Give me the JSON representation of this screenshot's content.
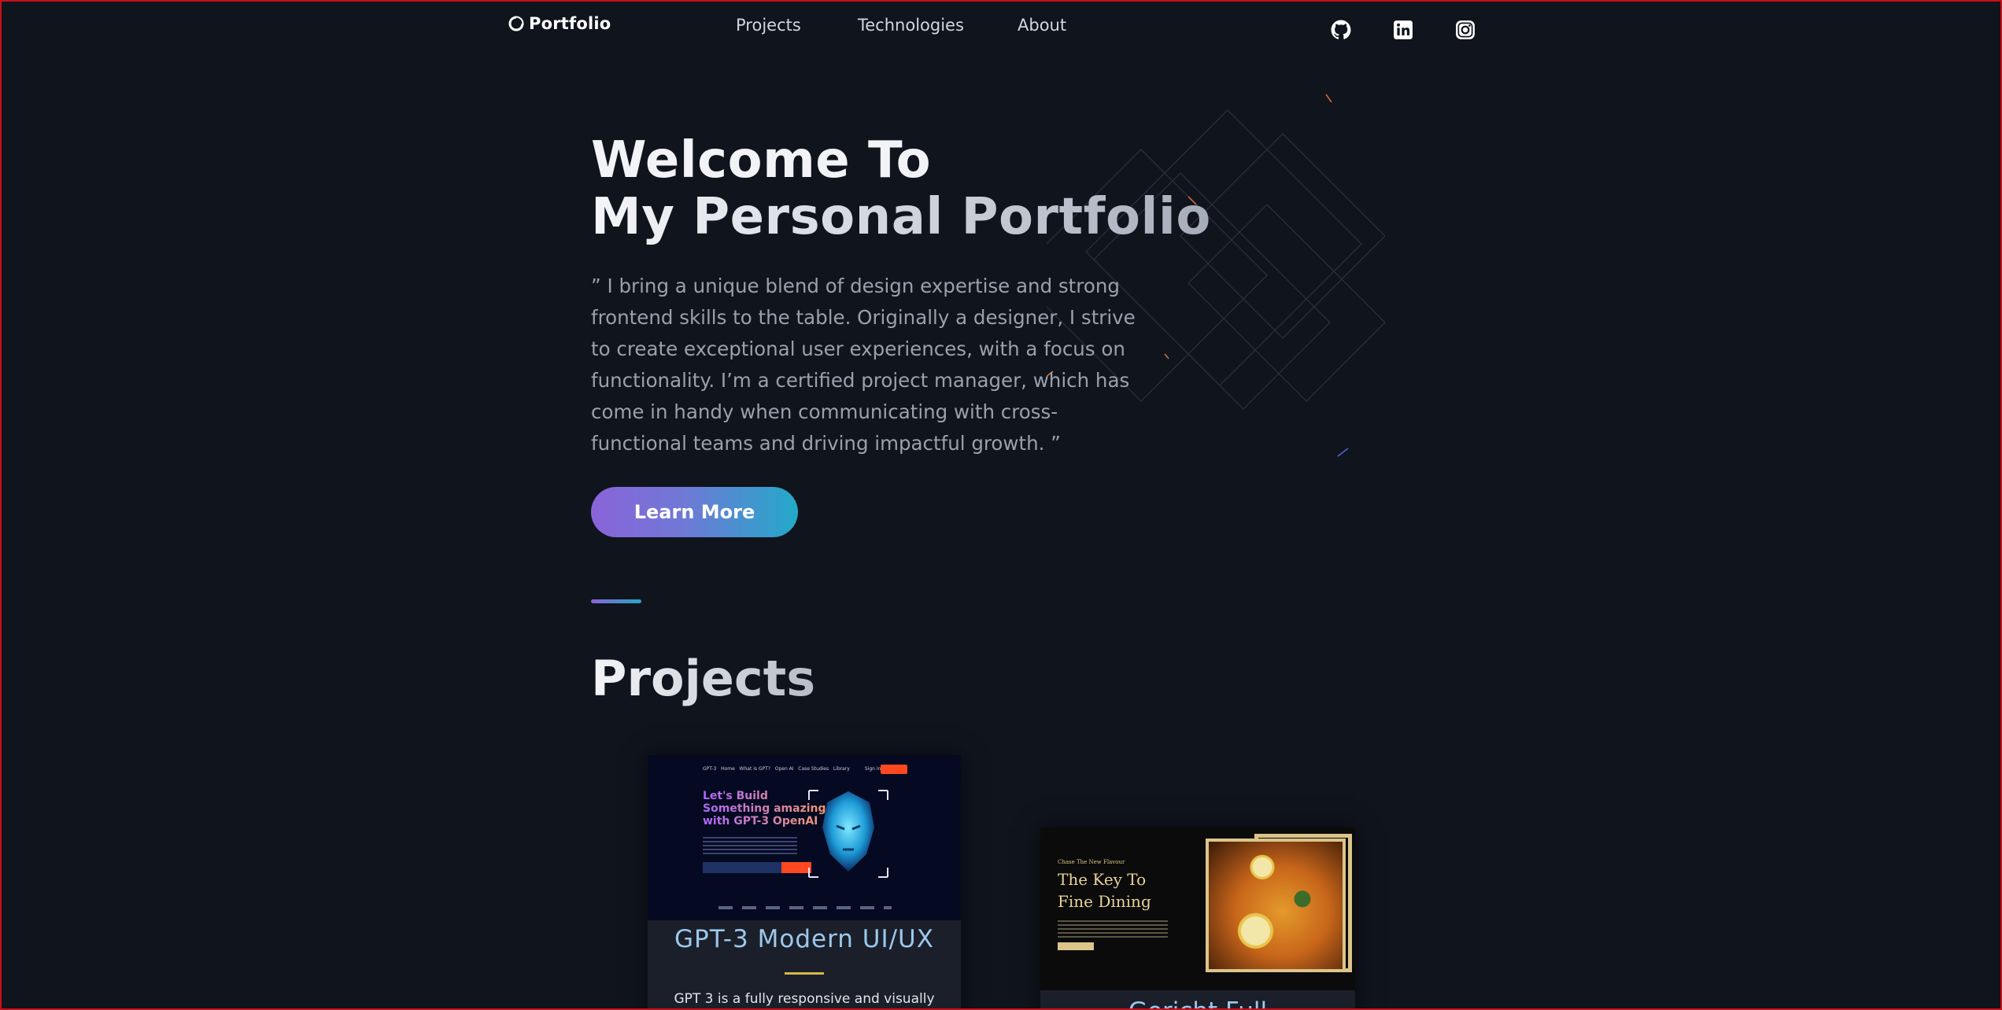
{
  "nav": {
    "logo": "Portfolio",
    "links": [
      "Projects",
      "Technologies",
      "About"
    ],
    "social": [
      "github-icon",
      "linkedin-icon",
      "instagram-icon"
    ]
  },
  "hero": {
    "title_line1": "Welcome To",
    "title_line2": "My Personal Portfolio",
    "quote": "” I bring a unique blend of design expertise and strong frontend skills to the table. Originally a designer, I strive to create exceptional user experiences, with a focus on functionality. I’m a certified project manager, which has come in handy when communicating with cross-functional teams and driving impactful growth. ”",
    "cta": "Learn More"
  },
  "projects": {
    "heading": "Projects",
    "cards": [
      {
        "title": "GPT-3 Modern UI/UX",
        "desc": "GPT 3 is a fully responsive and visually",
        "thumb_headline": "Let's Build Something amazing with GPT-3 OpenAI"
      },
      {
        "title": "Gericht Full",
        "thumb_subtitle": "Chase The New Flavour",
        "thumb_headline": "The Key To Fine Dining"
      }
    ]
  },
  "colors": {
    "background": "#10141d",
    "accent_purple": "#8a63d9",
    "accent_cyan": "#22a9c8",
    "card_title": "#9cc8ec",
    "card_rule": "#d4b84a",
    "border": "#c8101a"
  }
}
